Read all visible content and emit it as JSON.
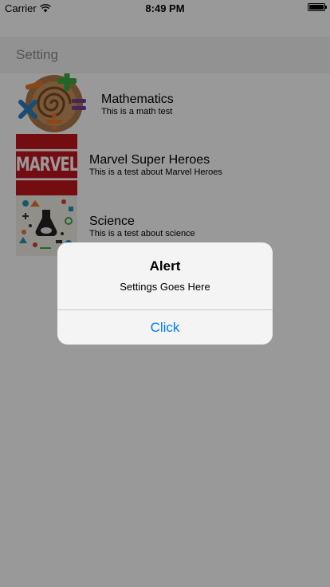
{
  "status_bar": {
    "carrier": "Carrier",
    "time": "8:49 PM",
    "icons": [
      "wifi-icon",
      "battery-icon"
    ]
  },
  "header": {
    "title": "Setting"
  },
  "list": {
    "items": [
      {
        "title": "Mathematics",
        "subtitle": "This is a math test",
        "icon": "math-symbols-image"
      },
      {
        "title": "Marvel Super Heroes",
        "subtitle": "This is a test about Marvel Heroes",
        "icon": "marvel-logo-image",
        "logo_text": "MARVEL"
      },
      {
        "title": "Science",
        "subtitle": "This is a test about science",
        "icon": "science-doodles-image"
      }
    ]
  },
  "alert": {
    "title": "Alert",
    "message": "Settings Goes Here",
    "button_label": "Click"
  },
  "colors": {
    "accent": "#007aff",
    "marvel_red": "#c0171e",
    "overlay": "rgba(0,0,0,0.4)"
  }
}
